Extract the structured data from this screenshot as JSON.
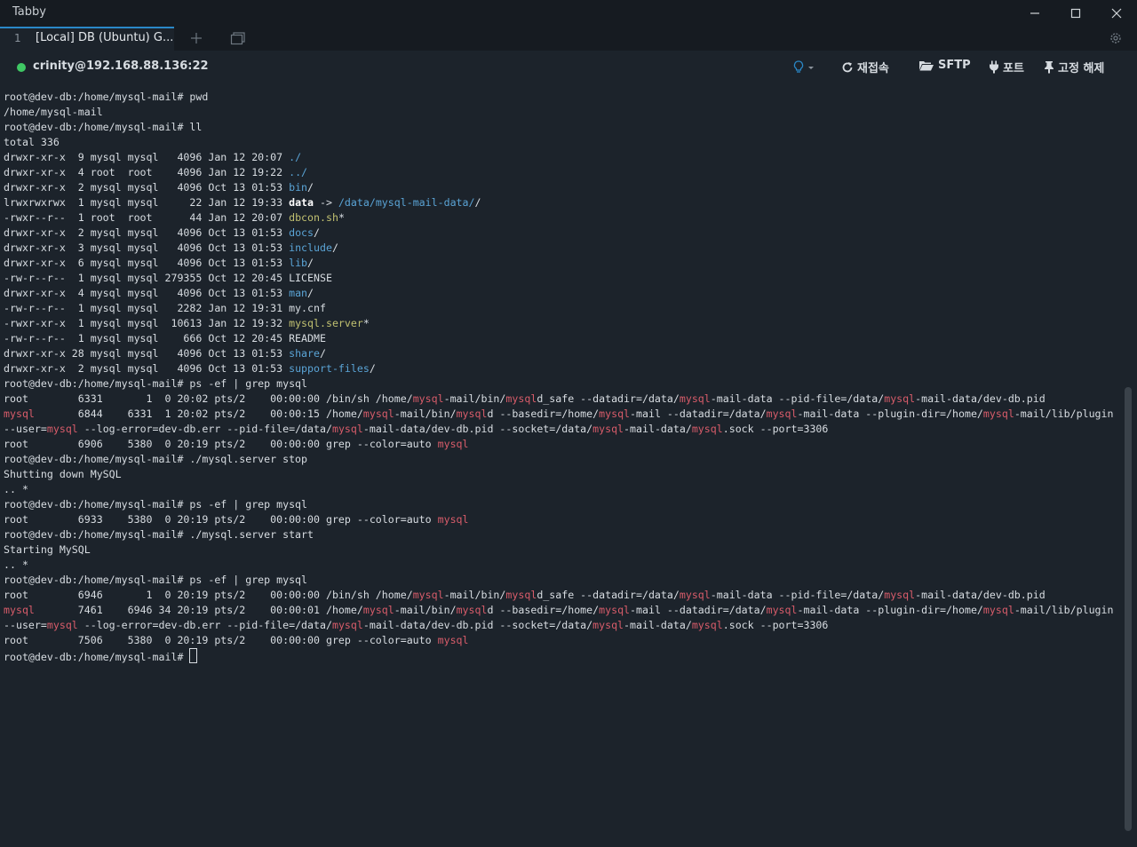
{
  "app": {
    "title": "Tabby",
    "tab": {
      "number": "1",
      "title": "[Local] DB (Ubuntu) G..."
    },
    "connection": "crinity@192.168.88.136:22",
    "toolbar": {
      "reconnect": "재접속",
      "sftp": "SFTP",
      "ports": "포트",
      "unpin": "고정 해제"
    },
    "colors": {
      "accent": "#2a88c8",
      "connected": "#3fc864",
      "magenta": "#d85c6a",
      "blue": "#5aa4d6",
      "yellow": "#c0c070"
    }
  },
  "terminal": {
    "lines": [
      [
        [
          "root@dev-db:/home/mysql-mail# pwd",
          ""
        ]
      ],
      [
        [
          "/home/mysql-mail",
          ""
        ]
      ],
      [
        [
          "root@dev-db:/home/mysql-mail# ll",
          ""
        ]
      ],
      [
        [
          "total 336",
          ""
        ]
      ],
      [
        [
          "drwxr-xr-x  9 mysql mysql   4096 Jan 12 20:07 ",
          ""
        ],
        [
          "./",
          "b"
        ]
      ],
      [
        [
          "drwxr-xr-x  4 root  root    4096 Jan 12 19:22 ",
          ""
        ],
        [
          "../",
          "b"
        ]
      ],
      [
        [
          "drwxr-xr-x  2 mysql mysql   4096 Oct 13 01:53 ",
          ""
        ],
        [
          "bin",
          "b"
        ],
        [
          "/",
          ""
        ]
      ],
      [
        [
          "lrwxrwxrwx  1 mysql mysql     22 Jan 12 19:33 ",
          ""
        ],
        [
          "data",
          "w"
        ],
        [
          " -> ",
          ""
        ],
        [
          "/data/mysql-mail-data/",
          "b"
        ],
        [
          "/",
          ""
        ]
      ],
      [
        [
          "-rwxr--r--  1 root  root      44 Jan 12 20:07 ",
          ""
        ],
        [
          "dbcon.sh",
          "y"
        ],
        [
          "*",
          ""
        ]
      ],
      [
        [
          "drwxr-xr-x  2 mysql mysql   4096 Oct 13 01:53 ",
          ""
        ],
        [
          "docs",
          "b"
        ],
        [
          "/",
          ""
        ]
      ],
      [
        [
          "drwxr-xr-x  3 mysql mysql   4096 Oct 13 01:53 ",
          ""
        ],
        [
          "include",
          "b"
        ],
        [
          "/",
          ""
        ]
      ],
      [
        [
          "drwxr-xr-x  6 mysql mysql   4096 Oct 13 01:53 ",
          ""
        ],
        [
          "lib",
          "b"
        ],
        [
          "/",
          ""
        ]
      ],
      [
        [
          "-rw-r--r--  1 mysql mysql 279355 Oct 12 20:45 LICENSE",
          ""
        ]
      ],
      [
        [
          "drwxr-xr-x  4 mysql mysql   4096 Oct 13 01:53 ",
          ""
        ],
        [
          "man",
          "b"
        ],
        [
          "/",
          ""
        ]
      ],
      [
        [
          "-rw-r--r--  1 mysql mysql   2282 Jan 12 19:31 my.cnf",
          ""
        ]
      ],
      [
        [
          "-rwxr-xr-x  1 mysql mysql  10613 Jan 12 19:32 ",
          ""
        ],
        [
          "mysql.server",
          "y"
        ],
        [
          "*",
          ""
        ]
      ],
      [
        [
          "-rw-r--r--  1 mysql mysql    666 Oct 12 20:45 README",
          ""
        ]
      ],
      [
        [
          "drwxr-xr-x 28 mysql mysql   4096 Oct 13 01:53 ",
          ""
        ],
        [
          "share",
          "b"
        ],
        [
          "/",
          ""
        ]
      ],
      [
        [
          "drwxr-xr-x  2 mysql mysql   4096 Oct 13 01:53 ",
          ""
        ],
        [
          "support-files",
          "b"
        ],
        [
          "/",
          ""
        ]
      ],
      [
        [
          "root@dev-db:/home/mysql-mail# ps -ef | grep mysql",
          ""
        ]
      ],
      [
        [
          "root        6331       1  0 20:02 pts/2    00:00:00 /bin/sh /home/",
          ""
        ],
        [
          "mysql",
          "m"
        ],
        [
          "-mail/bin/",
          ""
        ],
        [
          "mysql",
          "m"
        ],
        [
          "d_safe --datadir=/data/",
          ""
        ],
        [
          "mysql",
          "m"
        ],
        [
          "-mail-data --pid-file=/data/",
          ""
        ],
        [
          "mysql",
          "m"
        ],
        [
          "-mail-data/dev-db.pid",
          ""
        ]
      ],
      [
        [
          "mysql",
          "m"
        ],
        [
          "       6844    6331  1 20:02 pts/2    00:00:15 /home/",
          ""
        ],
        [
          "mysql",
          "m"
        ],
        [
          "-mail/bin/",
          ""
        ],
        [
          "mysql",
          "m"
        ],
        [
          "d --basedir=/home/",
          ""
        ],
        [
          "mysql",
          "m"
        ],
        [
          "-mail --datadir=/data/",
          ""
        ],
        [
          "mysql",
          "m"
        ],
        [
          "-mail-data --plugin-dir=/home/",
          ""
        ],
        [
          "mysql",
          "m"
        ],
        [
          "-mail/lib/plugin",
          ""
        ]
      ],
      [
        [
          "--user=",
          ""
        ],
        [
          "mysql",
          "m"
        ],
        [
          " --log-error=dev-db.err --pid-file=/data/",
          ""
        ],
        [
          "mysql",
          "m"
        ],
        [
          "-mail-data/dev-db.pid --socket=/data/",
          ""
        ],
        [
          "mysql",
          "m"
        ],
        [
          "-mail-data/",
          ""
        ],
        [
          "mysql",
          "m"
        ],
        [
          ".sock --port=3306",
          ""
        ]
      ],
      [
        [
          "root        6906    5380  0 20:19 pts/2    00:00:00 grep --color=auto ",
          ""
        ],
        [
          "mysql",
          "m"
        ]
      ],
      [
        [
          "root@dev-db:/home/mysql-mail# ./mysql.server stop",
          ""
        ]
      ],
      [
        [
          "Shutting down MySQL",
          ""
        ]
      ],
      [
        [
          ".. *",
          ""
        ]
      ],
      [
        [
          "root@dev-db:/home/mysql-mail# ps -ef | grep mysql",
          ""
        ]
      ],
      [
        [
          "root        6933    5380  0 20:19 pts/2    00:00:00 grep --color=auto ",
          ""
        ],
        [
          "mysql",
          "m"
        ]
      ],
      [
        [
          "root@dev-db:/home/mysql-mail# ./mysql.server start",
          ""
        ]
      ],
      [
        [
          "Starting MySQL",
          ""
        ]
      ],
      [
        [
          ".. *",
          ""
        ]
      ],
      [
        [
          "root@dev-db:/home/mysql-mail# ps -ef | grep mysql",
          ""
        ]
      ],
      [
        [
          "root        6946       1  0 20:19 pts/2    00:00:00 /bin/sh /home/",
          ""
        ],
        [
          "mysql",
          "m"
        ],
        [
          "-mail/bin/",
          ""
        ],
        [
          "mysql",
          "m"
        ],
        [
          "d_safe --datadir=/data/",
          ""
        ],
        [
          "mysql",
          "m"
        ],
        [
          "-mail-data --pid-file=/data/",
          ""
        ],
        [
          "mysql",
          "m"
        ],
        [
          "-mail-data/dev-db.pid",
          ""
        ]
      ],
      [
        [
          "mysql",
          "m"
        ],
        [
          "       7461    6946 34 20:19 pts/2    00:00:01 /home/",
          ""
        ],
        [
          "mysql",
          "m"
        ],
        [
          "-mail/bin/",
          ""
        ],
        [
          "mysql",
          "m"
        ],
        [
          "d --basedir=/home/",
          ""
        ],
        [
          "mysql",
          "m"
        ],
        [
          "-mail --datadir=/data/",
          ""
        ],
        [
          "mysql",
          "m"
        ],
        [
          "-mail-data --plugin-dir=/home/",
          ""
        ],
        [
          "mysql",
          "m"
        ],
        [
          "-mail/lib/plugin",
          ""
        ]
      ],
      [
        [
          "--user=",
          ""
        ],
        [
          "mysql",
          "m"
        ],
        [
          " --log-error=dev-db.err --pid-file=/data/",
          ""
        ],
        [
          "mysql",
          "m"
        ],
        [
          "-mail-data/dev-db.pid --socket=/data/",
          ""
        ],
        [
          "mysql",
          "m"
        ],
        [
          "-mail-data/",
          ""
        ],
        [
          "mysql",
          "m"
        ],
        [
          ".sock --port=3306",
          ""
        ]
      ],
      [
        [
          "root        7506    5380  0 20:19 pts/2    00:00:00 grep --color=auto ",
          ""
        ],
        [
          "mysql",
          "m"
        ]
      ],
      [
        [
          "root@dev-db:/home/mysql-mail# ",
          ""
        ]
      ]
    ]
  }
}
